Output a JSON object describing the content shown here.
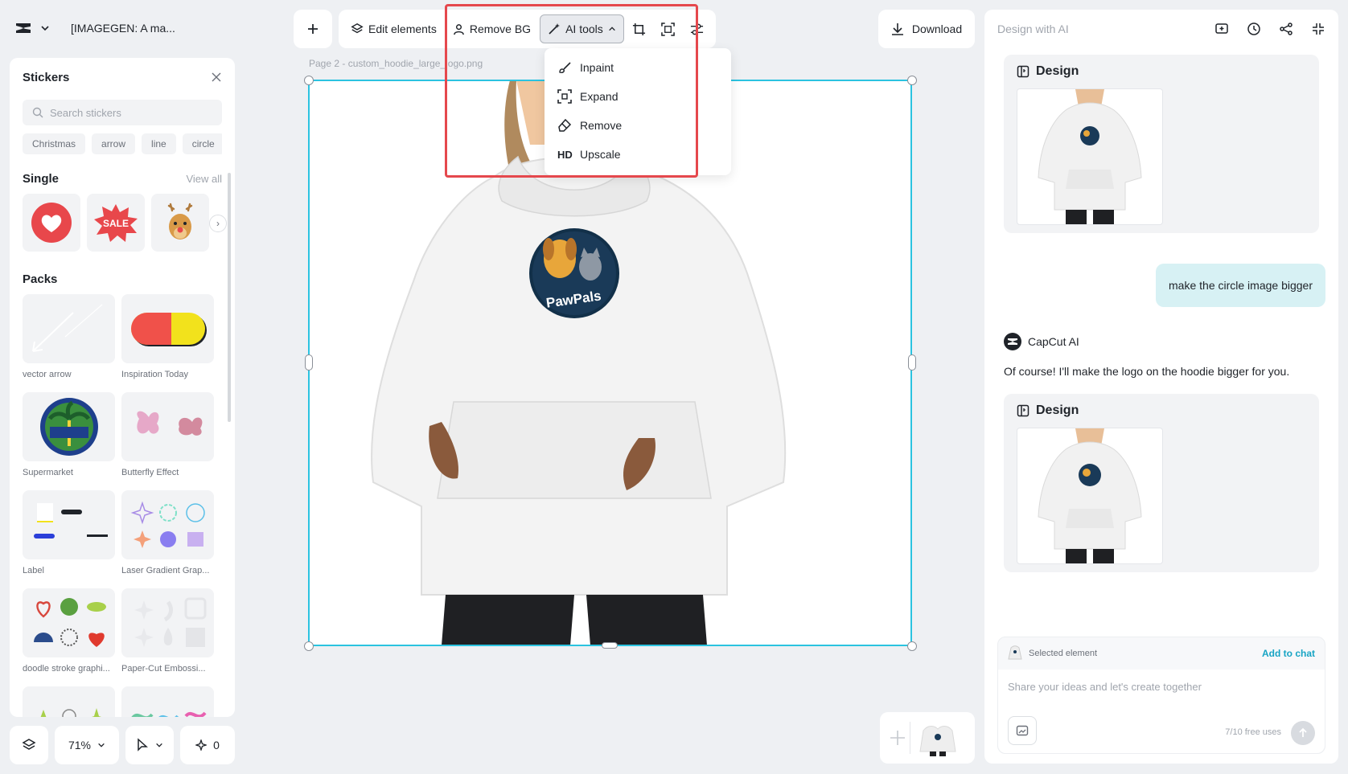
{
  "header": {
    "logo_icon": "capcut-logo-icon",
    "project_name": "[IMAGEGEN: A ma..."
  },
  "stickers_panel": {
    "title": "Stickers",
    "search_placeholder": "Search stickers",
    "chips": [
      "Christmas",
      "arrow",
      "line",
      "circle"
    ],
    "single_title": "Single",
    "view_all": "View all",
    "single_items": [
      "heart-sticker",
      "sale-sticker",
      "reindeer-sticker"
    ],
    "single_sale_text": "SALE",
    "packs_title": "Packs",
    "packs": [
      "vector arrow",
      "Inspiration Today",
      "Supermarket",
      "Butterfly Effect",
      "Label",
      "Laser Gradient Grap...",
      "doodle stroke graphi...",
      "Paper-Cut Embossi..."
    ]
  },
  "bottom_controls": {
    "zoom": "71%",
    "credits": "0"
  },
  "toolbar": {
    "edit_elements": "Edit elements",
    "remove_bg": "Remove BG",
    "ai_tools": "AI tools",
    "download": "Download"
  },
  "ai_tools_menu": {
    "items": [
      "Inpaint",
      "Expand",
      "Remove",
      "Upscale"
    ],
    "hd_badge": "HD"
  },
  "canvas": {
    "page_label": "Page 2 -  custom_hoodie_large_logo.png",
    "logo_text": "PawPals"
  },
  "ai_panel": {
    "title": "Design with AI",
    "design_card_title": "Design",
    "user_message": "make the circle image bigger",
    "assistant_name": "CapCut AI",
    "assistant_message": "Of course! I'll make the logo on the hoodie bigger for you.",
    "selected_element": "Selected element",
    "add_to_chat": "Add to chat",
    "input_placeholder": "Share your ideas and let's create together",
    "free_uses": "7/10 free uses"
  },
  "colors": {
    "selection": "#2bc3e0",
    "highlight": "#e5484d",
    "accent_link": "#17a4c4",
    "user_bubble": "#d7f1f4"
  }
}
